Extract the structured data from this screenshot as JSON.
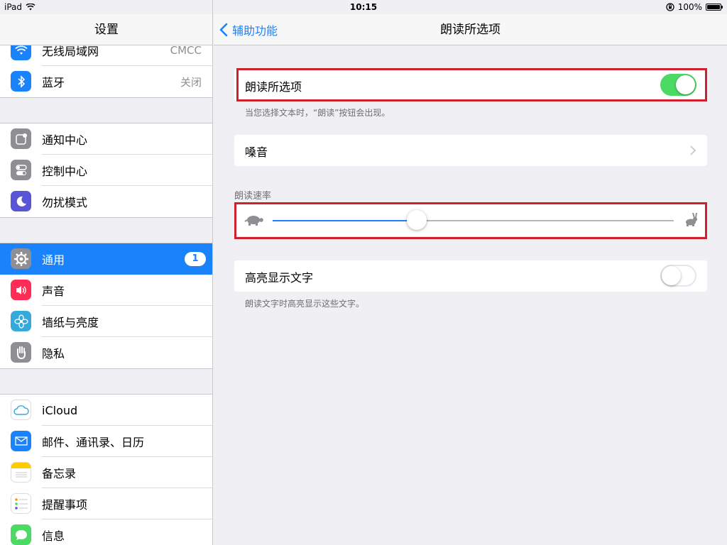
{
  "status_bar": {
    "device": "iPad",
    "time": "10:15",
    "battery": "100%"
  },
  "sidebar": {
    "title": "设置",
    "groups": [
      {
        "items": [
          {
            "label": "无线局域网",
            "value": "CMCC",
            "icon": "wifi-icon",
            "color": "#1a82fb"
          },
          {
            "label": "蓝牙",
            "value": "关闭",
            "icon": "bluetooth-icon",
            "color": "#1a82fb"
          }
        ]
      },
      {
        "items": [
          {
            "label": "通知中心",
            "icon": "notification-center-icon",
            "color": "#8e8e93"
          },
          {
            "label": "控制中心",
            "icon": "control-center-icon",
            "color": "#8e8e93"
          },
          {
            "label": "勿扰模式",
            "icon": "moon-icon",
            "color": "#5856d6"
          }
        ]
      },
      {
        "items": [
          {
            "label": "通用",
            "badge": "1",
            "icon": "gear-icon",
            "color": "#8e8e93",
            "selected": true
          },
          {
            "label": "声音",
            "icon": "speaker-icon",
            "color": "#ff2d55"
          },
          {
            "label": "墙纸与亮度",
            "icon": "flower-icon",
            "color": "#34aadc"
          },
          {
            "label": "隐私",
            "icon": "hand-icon",
            "color": "#8e8e93"
          }
        ]
      },
      {
        "items": [
          {
            "label": "iCloud",
            "icon": "cloud-icon",
            "color": "#ffffff"
          },
          {
            "label": "邮件、通讯录、日历",
            "icon": "mail-icon",
            "color": "#1a82fb"
          },
          {
            "label": "备忘录",
            "icon": "notes-icon",
            "color": "#ffcc00"
          },
          {
            "label": "提醒事项",
            "icon": "reminders-icon",
            "color": "#ffffff"
          },
          {
            "label": "信息",
            "icon": "messages-icon",
            "color": "#4cd964"
          }
        ]
      }
    ]
  },
  "detail": {
    "back_label": "辅助功能",
    "title": "朗读所选项",
    "speak_selection": {
      "label": "朗读所选项",
      "on": true,
      "footer": "当您选择文本时，“朗读”按钮会出现。"
    },
    "voice": {
      "label": "嗓音"
    },
    "speaking_rate": {
      "label": "朗读速率",
      "value_fraction": 0.36
    },
    "highlight": {
      "label": "高亮显示文字",
      "on": false,
      "footer": "朗读文字时高亮显示这些文字。"
    }
  },
  "colors": {
    "accent": "#1a82fb",
    "toggle_on": "#4cd964",
    "highlight_box": "#d0202e"
  }
}
